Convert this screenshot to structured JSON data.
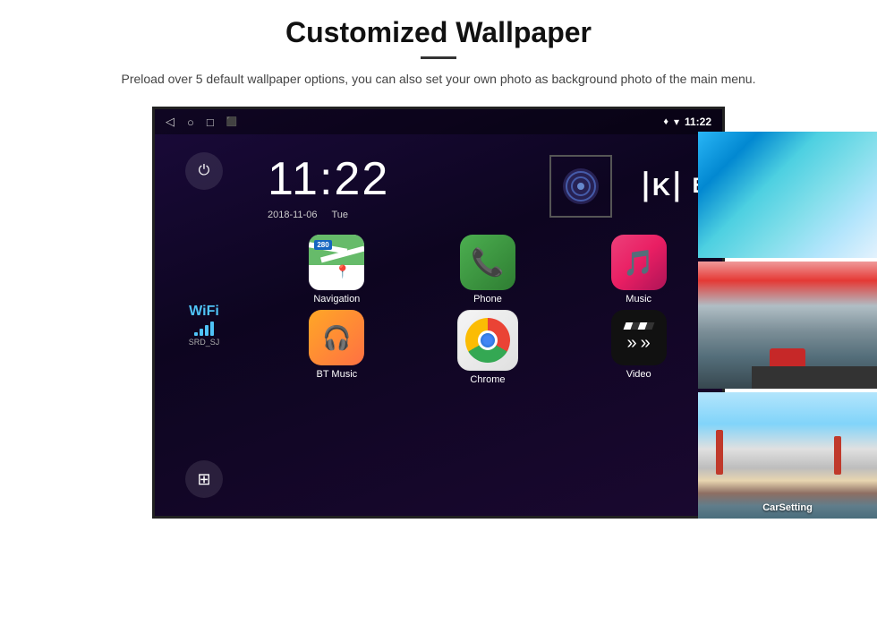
{
  "header": {
    "title": "Customized Wallpaper",
    "divider": true,
    "description": "Preload over 5 default wallpaper options, you can also set your own photo as background photo of the main menu."
  },
  "status_bar": {
    "time": "11:22",
    "nav_icons": [
      "◁",
      "○",
      "□",
      "⬛"
    ],
    "right_icons": [
      "♦",
      "▾"
    ],
    "location_icon": "♦"
  },
  "clock": {
    "time": "11:22",
    "date": "2018-11-06",
    "day": "Tue"
  },
  "wifi": {
    "label": "WiFi",
    "ssid": "SRD_SJ"
  },
  "apps": [
    {
      "id": "navigation",
      "label": "Navigation",
      "type": "nav"
    },
    {
      "id": "phone",
      "label": "Phone",
      "type": "phone"
    },
    {
      "id": "music",
      "label": "Music",
      "type": "music"
    },
    {
      "id": "btmusic",
      "label": "BT Music",
      "type": "btmusic"
    },
    {
      "id": "chrome",
      "label": "Chrome",
      "type": "chrome"
    },
    {
      "id": "video",
      "label": "Video",
      "type": "video"
    }
  ],
  "wallpapers": [
    {
      "id": "ice",
      "type": "ice"
    },
    {
      "id": "city",
      "type": "city"
    },
    {
      "id": "bridge",
      "type": "bridge",
      "label": "CarSetting"
    }
  ],
  "media": {
    "k_label": "K",
    "b_label": "B"
  }
}
